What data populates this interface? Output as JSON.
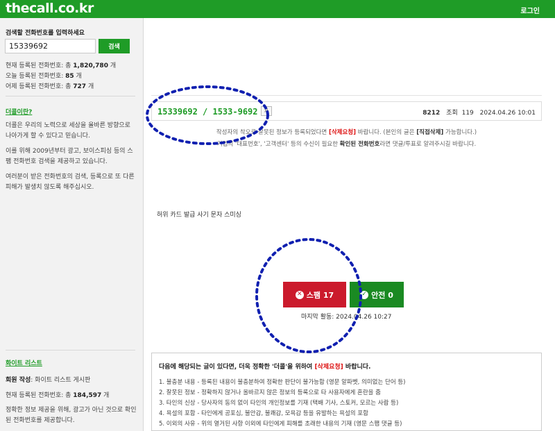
{
  "header": {
    "logo": "thecall.co.kr",
    "login": "로그인"
  },
  "sidebar": {
    "search_title": "검색할 전화번호를 입력하세요",
    "search_value": "15339692",
    "search_button": "검색",
    "stats": [
      {
        "label": "현재 등록된 전화번호: 총 ",
        "value": "1,820,780",
        "unit": " 개"
      },
      {
        "label": "오늘 등록된 전화번호: ",
        "value": "85",
        "unit": " 개"
      },
      {
        "label": "어제 등록된 전화번호: 총 ",
        "value": "727",
        "unit": " 개"
      }
    ],
    "about_link": "더콜이란?",
    "about_text": [
      "더콜은 우리의 노력으로 세상을 올바른 방향으로 나아가게 할 수 있다고 믿습니다.",
      "이를 위해 2009년부터 광고, 보이스피싱 등의 스팸 전화번호 검색을 제공하고 있습니다.",
      "여러분이 받은 전화번호의 검색, 등록으로 또 다른 피해가 발생치 않도록 해주십시오."
    ],
    "white_list_link": "화이트 리스트",
    "white_member_label": "회원 작성",
    "white_member_text": ": 화이트 리스트 게시판",
    "white_count_label": "현재 등록된 전화번호: 총 ",
    "white_count_value": "184,597",
    "white_count_unit": " 개",
    "white_note": "정확한 정보 제공을 위해, 광고가 아닌 것으로 확인된 전화번호를 제공합니다."
  },
  "post": {
    "phone_title": "15339692  /  1533-9692",
    "copy_chip": "자",
    "id": "8212",
    "views_label": "조회",
    "views": "119",
    "datetime": "2024.04.26 10:01",
    "notice1_a": "작성자의 착오로 잘못된 정보가 등록되었다면 ",
    "notice1_red": "[삭제요청]",
    "notice1_b": " 바랍니다. (본인의 글은 ",
    "notice1_bold": "[직접삭제]",
    "notice1_c": " 가능합니다.)",
    "notice2_a": "기업의 '대표번호', '고객센터' 등의 수신이 필요한 ",
    "notice2_bold": "확인된 전화번호",
    "notice2_b": "라면 댓글/투표로 알려주시길 바랍니다.",
    "body": "허위 카드 발급 사기 문자 스미싱"
  },
  "vote": {
    "spam_label": "스팸 17",
    "safe_label": "안전 0",
    "last_activity": "마지막 활동: 2024.04.26 10:27",
    "spam_icon": "x-circle-icon",
    "safe_icon": "check-circle-icon",
    "spam_color": "#cb1a2c",
    "safe_color": "#1a8a22"
  },
  "rules": {
    "head_a": "다음에 해당되는 글이 있다면, 더욱 정확한 '더콜'을 위하여 ",
    "head_red": "[삭제요청]",
    "head_b": " 바랍니다.",
    "items": [
      "1. 불충분 내용 - 등록된 내용이 불충분하여 정확한 판단이 불가능함 (영문 알파벳, 의미없는 단어 등)",
      "2. 잘못된 정보 - 정확하지 않거나 올바르지 않은 정보의 등록으로 타 사용자에게 혼란을 줌",
      "3. 타인의 신상 - 당사자의 동의 없이 타인의 개인정보를 기재 (택배 기사, 스토커, 모르는 사람 등)",
      "4. 욕설의 포함 - 타인에게 공포심, 불안감, 불쾌감, 모욕감 등을 유발하는 욕설의 포함",
      "5. 이외의 사유 - 위의 열거된 사항 이외에 타인에게 피해를 초래한 내용의 기재 (영문 스팸 댓글 등)"
    ]
  },
  "colors": {
    "brand_green": "#1f9c27",
    "annotation_blue": "#1020b0"
  }
}
